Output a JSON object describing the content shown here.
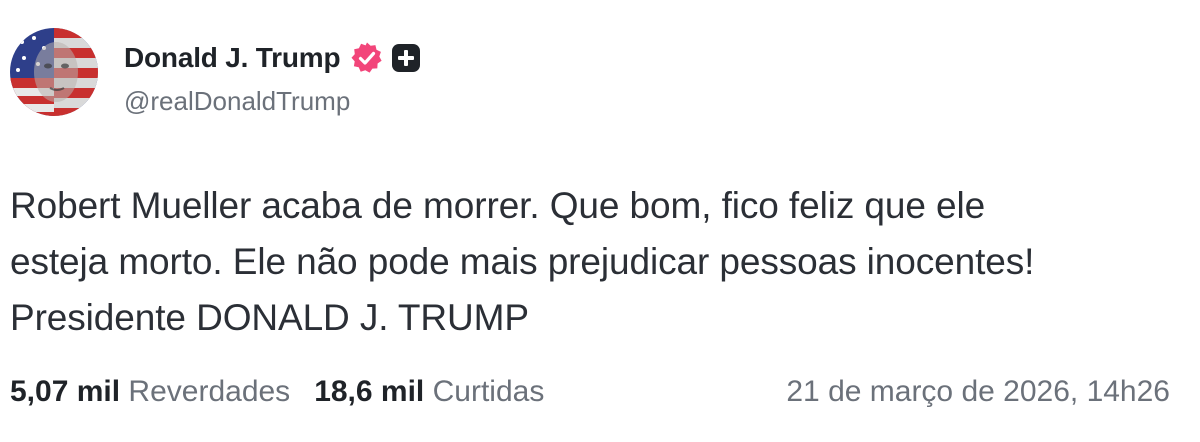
{
  "author": {
    "display_name": "Donald J. Trump",
    "handle": "@realDonaldTrump",
    "avatar_icon": "avatar-flag-portrait",
    "verified_color": "#f2457a"
  },
  "post": {
    "lines": [
      "Robert Mueller acaba de morrer. Que bom, fico feliz que ele",
      "esteja morto. Ele não pode mais prejudicar pessoas inocentes!",
      "Presidente DONALD J. TRUMP"
    ]
  },
  "stats": {
    "reposts_count": "5,07 mil",
    "reposts_label": "Reverdades",
    "likes_count": "18,6 mil",
    "likes_label": "Curtidas",
    "timestamp": "21 de março de 2026, 14h26"
  }
}
